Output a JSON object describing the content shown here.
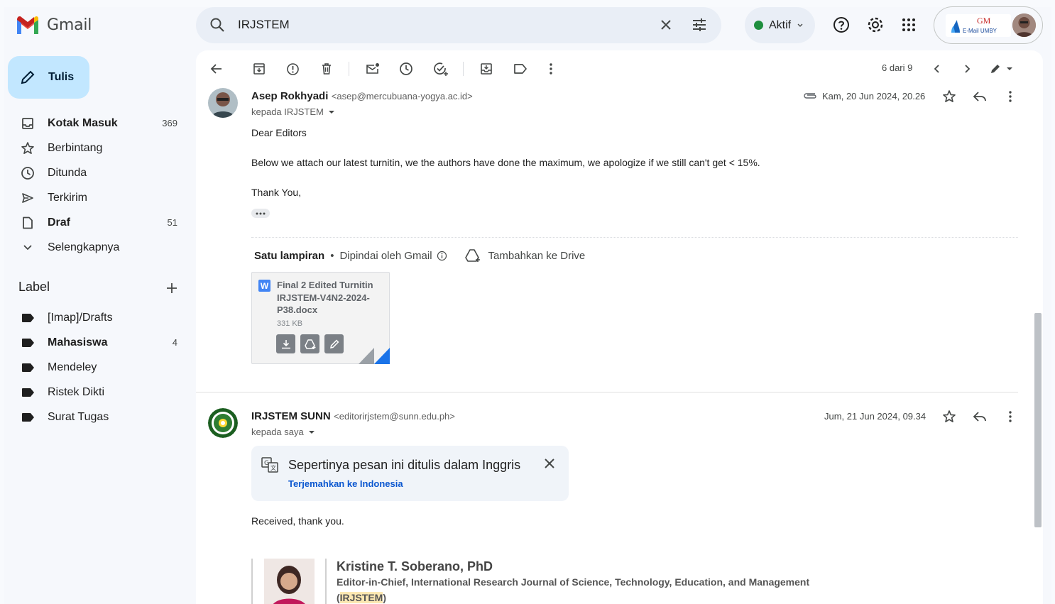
{
  "app": {
    "name": "Gmail"
  },
  "search": {
    "query": "IRJSTEM"
  },
  "status": {
    "label": "Aktif"
  },
  "account": {
    "logo_mark": "GM",
    "logo_label": "E-Mail UMBY"
  },
  "compose": {
    "label": "Tulis"
  },
  "nav": {
    "items": [
      {
        "label": "Kotak Masuk",
        "count": "369",
        "icon": "inbox-icon"
      },
      {
        "label": "Berbintang",
        "count": "",
        "icon": "star-icon"
      },
      {
        "label": "Ditunda",
        "count": "",
        "icon": "clock-icon"
      },
      {
        "label": "Terkirim",
        "count": "",
        "icon": "send-icon"
      },
      {
        "label": "Draf",
        "count": "51",
        "icon": "draft-icon"
      },
      {
        "label": "Selengkapnya",
        "count": "",
        "icon": "chevron-down-icon"
      }
    ]
  },
  "labels": {
    "heading": "Label",
    "items": [
      {
        "label": "[Imap]/Drafts",
        "count": ""
      },
      {
        "label": "Mahasiswa",
        "count": "4"
      },
      {
        "label": "Mendeley",
        "count": ""
      },
      {
        "label": "Ristek Dikti",
        "count": ""
      },
      {
        "label": "Surat Tugas",
        "count": ""
      }
    ]
  },
  "toolbar": {
    "pager": "6 dari 9"
  },
  "messages": [
    {
      "from": "Asep Rokhyadi",
      "email": "<asep@mercubuana-yogya.ac.id>",
      "to": "kepada IRJSTEM",
      "date": "Kam, 20 Jun 2024, 20.26",
      "body": [
        "Dear Editors",
        "Below we attach our latest turnitin, we the authors have done the maximum, we apologize if we still can't get < 15%.",
        "Thank You,"
      ],
      "attachments_header": {
        "title": "Satu lampiran",
        "scanned": "Dipindai oleh Gmail",
        "add_drive": "Tambahkan ke Drive"
      },
      "attachment": {
        "name": "Final 2 Edited Turnitin IRJSTEM-V4N2-2024-P38.docx",
        "size": "331 KB",
        "type_badge": "W"
      }
    },
    {
      "from": "IRJSTEM SUNN",
      "email": "<editorirjstem@sunn.edu.ph>",
      "to": "kepada saya",
      "date": "Jum, 21 Jun 2024, 09.34",
      "translate": {
        "text": "Sepertinya pesan ini ditulis dalam Inggris",
        "link": "Terjemahkan ke Indonesia"
      },
      "body": [
        "Received, thank you."
      ],
      "signature": {
        "name": "Kristine T. Soberano, PhD",
        "title": "Editor-in-Chief, International Research Journal of Science, Technology, Education, and Management",
        "abbrev": "IRJSTEM"
      }
    }
  ],
  "colors": {
    "compose_bg": "#c2e7ff",
    "status_dot": "#1e8e3e",
    "link": "#0b57d0",
    "highlight": "#fce8b2"
  }
}
